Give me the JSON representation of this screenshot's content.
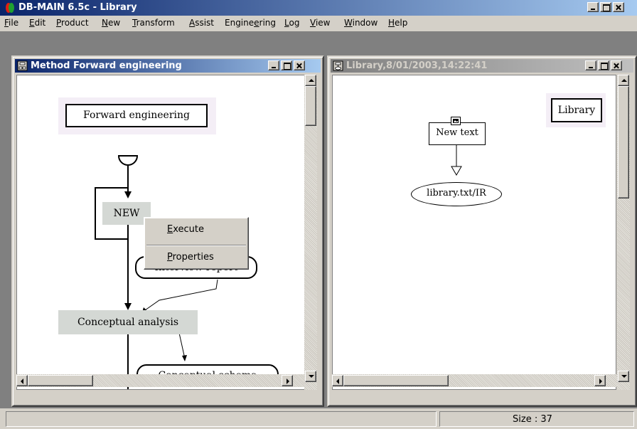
{
  "app": {
    "title": "DB-MAIN 6.5c - Library"
  },
  "menubar": {
    "items": [
      {
        "label": "File",
        "ul": "F",
        "rest": "ile"
      },
      {
        "label": "Edit",
        "ul": "E",
        "rest": "dit"
      },
      {
        "label": "Product",
        "ul": "P",
        "rest": "roduct"
      },
      {
        "label": "New",
        "ul": "N",
        "rest": "ew"
      },
      {
        "label": "Transform",
        "ul": "T",
        "rest": "ransform"
      },
      {
        "label": "Assist",
        "ul": "A",
        "rest": "ssist"
      },
      {
        "label": "Engineering",
        "pre": "Engine",
        "ul": "e",
        "rest": "ring"
      },
      {
        "label": "Log",
        "ul": "L",
        "rest": "og"
      },
      {
        "label": "View",
        "ul": "V",
        "rest": "iew"
      },
      {
        "label": "Window",
        "ul": "W",
        "rest": "indow"
      },
      {
        "label": "Help",
        "ul": "H",
        "rest": "elp"
      }
    ]
  },
  "method_window": {
    "title": "Method Forward engineering",
    "nodes": {
      "forward_engineering": "Forward engineering",
      "new": "NEW",
      "interview_report": "Interview report",
      "conceptual_analysis": "Conceptual analysis",
      "conceptual_schema": "Conceptual schema"
    }
  },
  "context_menu": {
    "execute": {
      "ul": "E",
      "rest": "xecute"
    },
    "properties": {
      "ul": "P",
      "rest": "roperties"
    }
  },
  "library_window": {
    "title": "Library,8/01/2003,14:22:41",
    "nodes": {
      "library": "Library",
      "new_text": "New text",
      "library_txt": "library.txt/IR"
    }
  },
  "statusbar": {
    "size_text": "Size : 37"
  }
}
